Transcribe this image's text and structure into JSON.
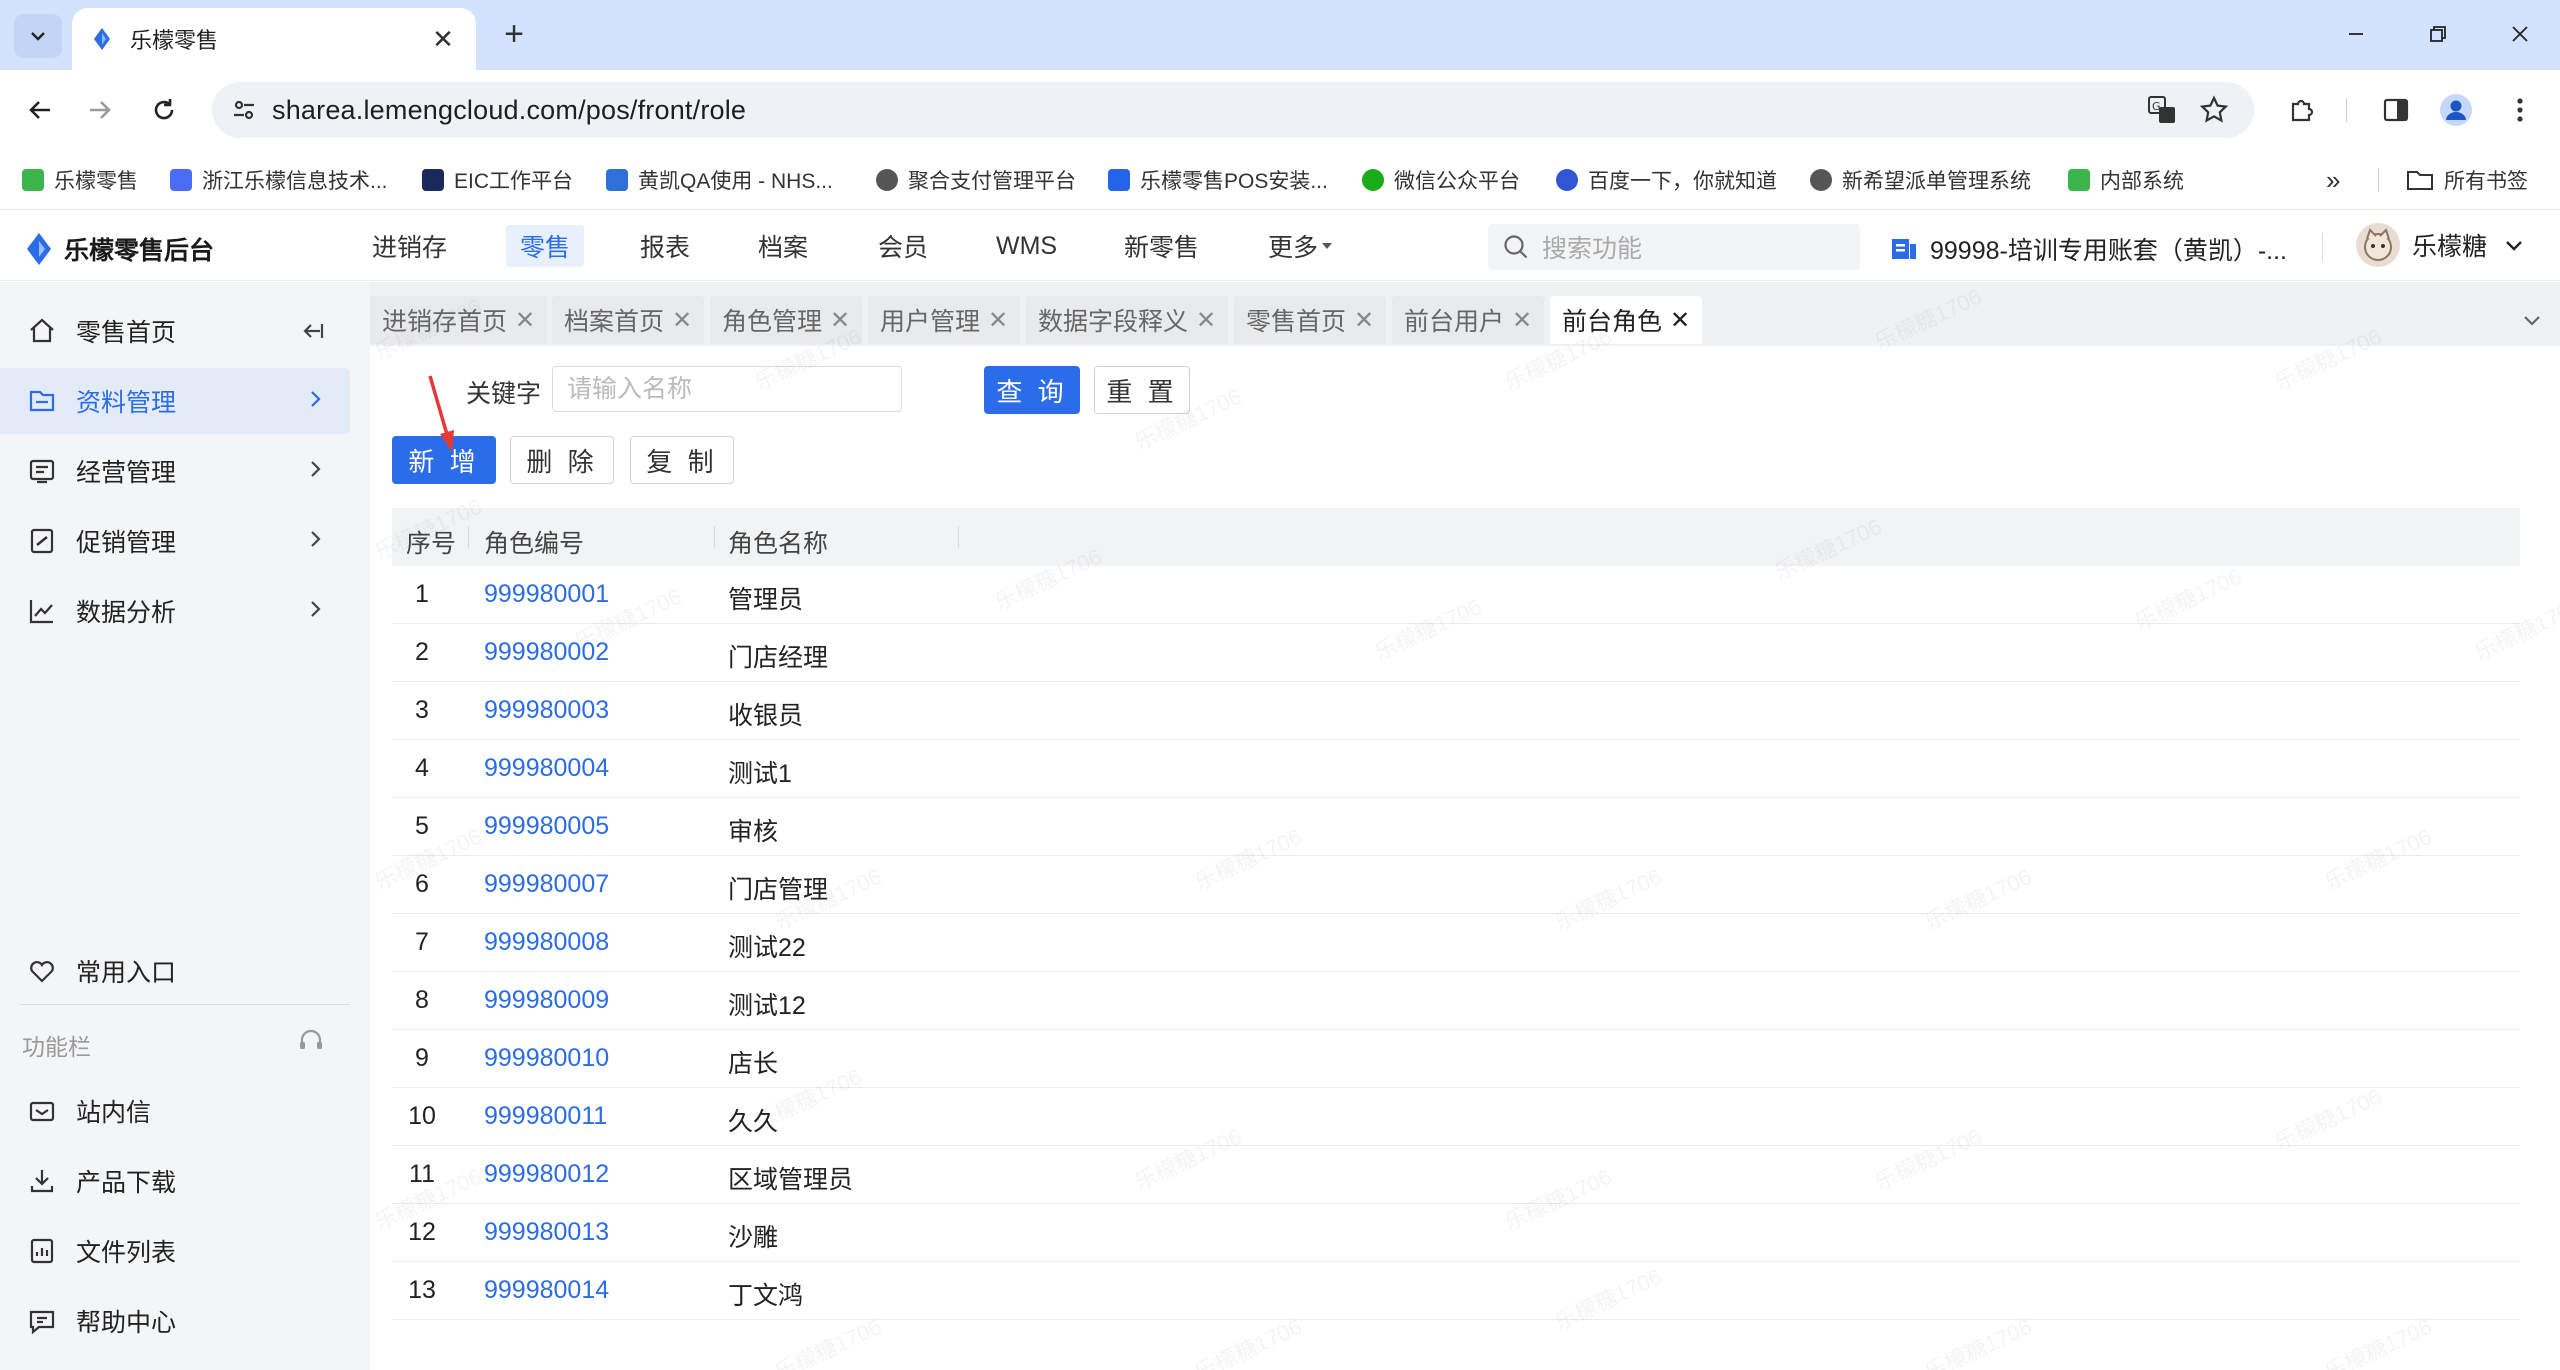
{
  "browser": {
    "tab_title": "乐檬零售",
    "url": "sharea.lemengcloud.com/pos/front/role",
    "bookmarks": [
      {
        "label": "乐檬零售",
        "color": "#3bb54a"
      },
      {
        "label": "浙江乐檬信息技术...",
        "color": "#4a6cf7"
      },
      {
        "label": "EIC工作平台",
        "color": "#1b2a5c"
      },
      {
        "label": "黄凯QA使用 - NHS...",
        "color": "#2f6fd8"
      },
      {
        "label": "聚合支付管理平台",
        "color": "#555555"
      },
      {
        "label": "乐檬零售POS安装...",
        "color": "#2563eb"
      },
      {
        "label": "微信公众平台",
        "color": "#1aad19"
      },
      {
        "label": "百度一下，你就知道",
        "color": "#3056d3"
      },
      {
        "label": "新希望派单管理系统",
        "color": "#555555"
      },
      {
        "label": "内部系统",
        "color": "#3bb54a"
      }
    ],
    "overflow": "»",
    "all_bookmarks": "所有书签"
  },
  "app": {
    "logo_text": "乐檬零售后台",
    "topnav": [
      "进销存",
      "零售",
      "报表",
      "档案",
      "会员",
      "WMS",
      "新零售",
      "更多"
    ],
    "active_topnav": "零售",
    "search_placeholder": "搜索功能",
    "account": "99998-培训专用账套（黄凯）-...",
    "user_name": "乐檬糖"
  },
  "sidebar": {
    "items": [
      {
        "label": "零售首页",
        "icon": "home-icon"
      },
      {
        "label": "资料管理",
        "icon": "folder-icon"
      },
      {
        "label": "经营管理",
        "icon": "manage-icon"
      },
      {
        "label": "促销管理",
        "icon": "promo-icon"
      },
      {
        "label": "数据分析",
        "icon": "chart-line-icon"
      }
    ],
    "active": "资料管理",
    "common_entry": "常用入口",
    "function_bar": "功能栏",
    "bottom_items": [
      {
        "label": "站内信",
        "icon": "mail-icon"
      },
      {
        "label": "产品下载",
        "icon": "download-icon"
      },
      {
        "label": "文件列表",
        "icon": "file-list-icon"
      },
      {
        "label": "帮助中心",
        "icon": "help-icon"
      }
    ]
  },
  "page_tabs": [
    "进销存首页",
    "档案首页",
    "角色管理",
    "用户管理",
    "数据字段释义",
    "零售首页",
    "前台用户",
    "前台角色"
  ],
  "active_page_tab": "前台角色",
  "filter": {
    "keyword_label": "关键字",
    "keyword_placeholder": "请输入名称",
    "query": "查 询",
    "reset": "重 置"
  },
  "actions": {
    "add": "新 增",
    "delete": "删 除",
    "copy": "复 制"
  },
  "table": {
    "headers": [
      "序号",
      "角色编号",
      "角色名称"
    ],
    "rows": [
      [
        "1",
        "999980001",
        "管理员"
      ],
      [
        "2",
        "999980002",
        "门店经理"
      ],
      [
        "3",
        "999980003",
        "收银员"
      ],
      [
        "4",
        "999980004",
        "测试1"
      ],
      [
        "5",
        "999980005",
        "审核"
      ],
      [
        "6",
        "999980007",
        "门店管理"
      ],
      [
        "7",
        "999980008",
        "测试22"
      ],
      [
        "8",
        "999980009",
        "测试12"
      ],
      [
        "9",
        "999980010",
        "店长"
      ],
      [
        "10",
        "999980011",
        "久久"
      ],
      [
        "11",
        "999980012",
        "区域管理员"
      ],
      [
        "12",
        "999980013",
        "沙雕"
      ],
      [
        "13",
        "999980014",
        "丁文鸿"
      ]
    ]
  },
  "watermark": "乐檬糖1706",
  "colors": {
    "accent": "#2b6ce8",
    "tabstrip": "#d3e3fd",
    "sidebar_bg": "#f4f5f7"
  }
}
